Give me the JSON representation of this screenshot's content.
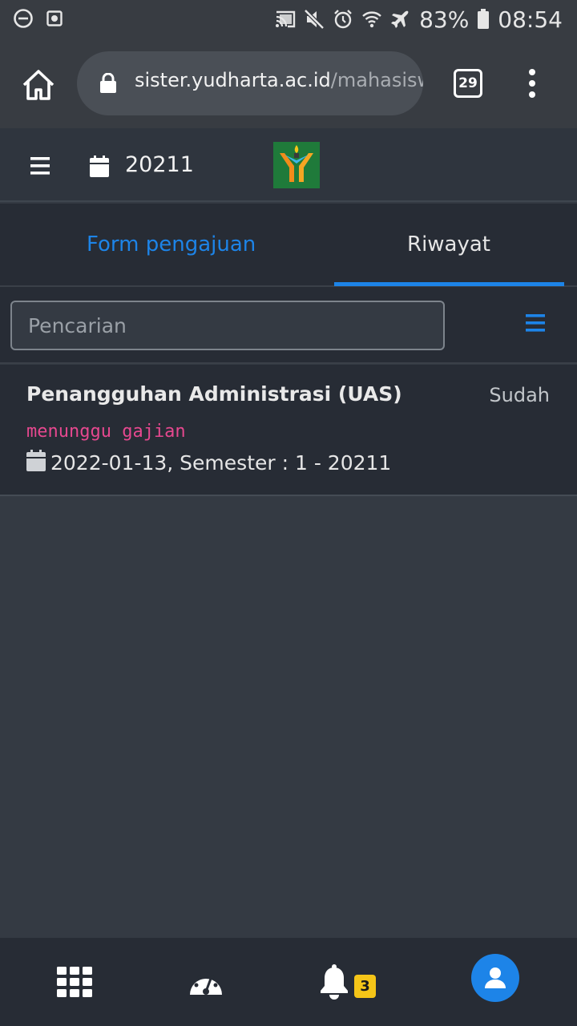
{
  "status_bar": {
    "battery_percent": "83%",
    "time": "08:54",
    "left_icons": [
      "do-not-disturb-icon",
      "screenshot-icon"
    ],
    "right_icons": [
      "cast-icon",
      "mute-icon",
      "alarm-icon",
      "wifi-icon",
      "airplane-icon",
      "battery-icon"
    ]
  },
  "browser": {
    "url_domain": "sister.yudharta.ac.id",
    "url_path": "/mahasisw",
    "tab_count": "29"
  },
  "header": {
    "semester": "20211"
  },
  "tabs": [
    {
      "label": "Form pengajuan",
      "active": false
    },
    {
      "label": "Riwayat",
      "active": true
    }
  ],
  "search": {
    "placeholder": "Pencarian",
    "value": ""
  },
  "items": [
    {
      "title": "Penangguhan Administrasi (UAS)",
      "status": "Sudah",
      "note": "menunggu gajian",
      "date_info": "2022-01-13, Semester : 1 - 20211"
    }
  ],
  "bottom_nav": {
    "notification_count": "3",
    "items": [
      "grid-icon",
      "dashboard-icon",
      "bell-icon",
      "user-icon"
    ]
  },
  "colors": {
    "accent": "#1d84e8",
    "note": "#e6488f",
    "badge": "#f5c518",
    "background": "#343a43",
    "surface": "#272c35"
  }
}
